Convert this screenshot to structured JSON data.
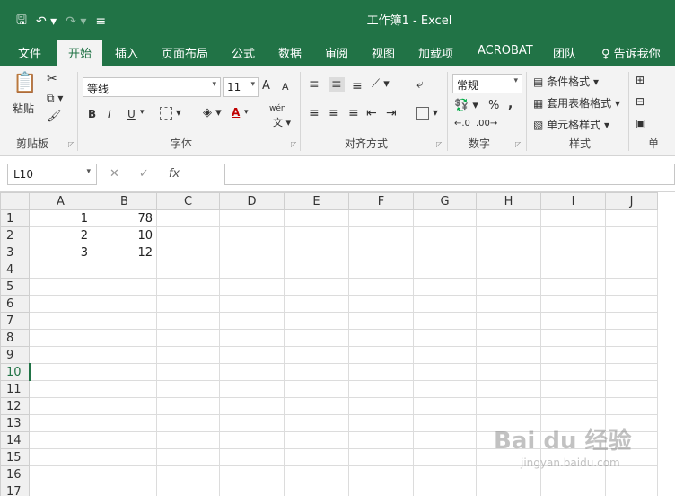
{
  "titlebar": {
    "save_icon": "save-icon",
    "undo_icon": "undo-icon",
    "redo_icon": "redo-icon",
    "customize_icon": "customize-qat-icon",
    "title": "工作簿1 - Excel",
    "bg_color": "#217346"
  },
  "menu": {
    "tabs": [
      "文件",
      "开始",
      "插入",
      "页面布局",
      "公式",
      "数据",
      "审阅",
      "视图",
      "加载项",
      "ACROBAT",
      "团队"
    ],
    "active": "开始",
    "tell_me": "♀ 告诉我你"
  },
  "ribbon": {
    "clipboard": {
      "paste": "粘贴",
      "label": "剪贴板"
    },
    "font": {
      "name": "等线",
      "size": "11",
      "bold": "B",
      "italic": "I",
      "underline": "U",
      "grow": "A",
      "shrink": "A",
      "color_a": "A",
      "label": "字体",
      "wen": "wén"
    },
    "alignment": {
      "label": "对齐方式"
    },
    "number": {
      "format": "常规",
      "percent": "%",
      "comma": ",",
      "label": "数字"
    },
    "styles": {
      "conditional": "条件格式",
      "table": "套用表格格式",
      "cell": "单元格样式",
      "label": "样式"
    },
    "cells": {
      "label": "单"
    }
  },
  "formula_bar": {
    "name_box": "L10",
    "cancel": "✕",
    "enter": "✓",
    "fx": "fx",
    "value": ""
  },
  "grid": {
    "columns": [
      "A",
      "B",
      "C",
      "D",
      "E",
      "F",
      "G",
      "H",
      "I",
      "J"
    ],
    "rows": [
      "1",
      "2",
      "3",
      "4",
      "5",
      "6",
      "7",
      "8",
      "9",
      "10",
      "11",
      "12",
      "13",
      "14",
      "15",
      "16",
      "17"
    ],
    "cells": {
      "A1": "1",
      "B1": "78",
      "A2": "2",
      "B2": "10",
      "A3": "3",
      "B3": "12"
    },
    "selected_row": "10"
  },
  "watermark": {
    "main": "Bai du 经验",
    "sub": "jingyan.baidu.com"
  }
}
